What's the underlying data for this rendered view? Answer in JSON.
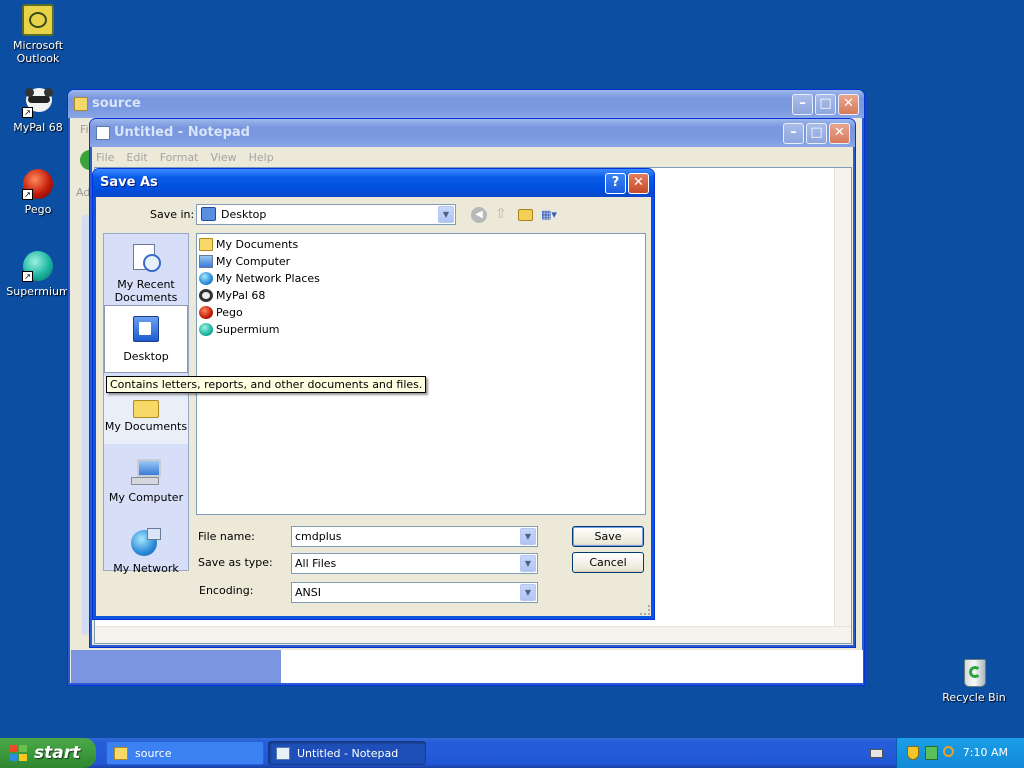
{
  "desktop": {
    "icons": [
      {
        "label": "Microsoft Outlook",
        "icon": "outlook-icon"
      },
      {
        "label": "MyPal 68",
        "icon": "raccoon-icon"
      },
      {
        "label": "Pego",
        "icon": "red-ball-icon"
      },
      {
        "label": "Supermium",
        "icon": "globe-icon"
      },
      {
        "label": "Recycle Bin",
        "icon": "recycle-bin-icon"
      }
    ]
  },
  "explorer_window": {
    "title": "source",
    "menu_first_letter": "Fi",
    "addr_prefix": "Ad"
  },
  "notepad_window": {
    "title": "Untitled - Notepad",
    "menu": [
      "File",
      "Edit",
      "Format",
      "View",
      "Help"
    ]
  },
  "save_dialog": {
    "title": "Save As",
    "save_in_label": "Save in:",
    "save_in_value": "Desktop",
    "places": [
      "My Recent Documents",
      "Desktop",
      "My Documents",
      "My Computer",
      "My Network"
    ],
    "tooltip": "Contains letters, reports, and other documents and files.",
    "files": [
      {
        "name": "My Documents",
        "icon": "folder-icon"
      },
      {
        "name": "My Computer",
        "icon": "computer-icon"
      },
      {
        "name": "My Network Places",
        "icon": "network-icon"
      },
      {
        "name": "MyPal 68",
        "icon": "raccoon-icon"
      },
      {
        "name": "Pego",
        "icon": "red-ball-icon"
      },
      {
        "name": "Supermium",
        "icon": "globe-icon"
      }
    ],
    "file_name_label": "File name:",
    "file_name_value": "cmdplus",
    "save_type_label": "Save as type:",
    "save_type_value": "All Files",
    "encoding_label": "Encoding:",
    "encoding_value": "ANSI",
    "save_button": "Save",
    "cancel_button": "Cancel"
  },
  "taskbar": {
    "start_label": "start",
    "buttons": [
      {
        "label": "source",
        "icon": "folder-icon"
      },
      {
        "label": "Untitled - Notepad",
        "icon": "notepad-icon"
      }
    ],
    "clock": "7:10 AM"
  },
  "colors": {
    "desktop": "#0b4ea2",
    "titlebar_active": "#0a5ce8",
    "dialog_face": "#ece9d8",
    "selection": "#316ac5"
  }
}
